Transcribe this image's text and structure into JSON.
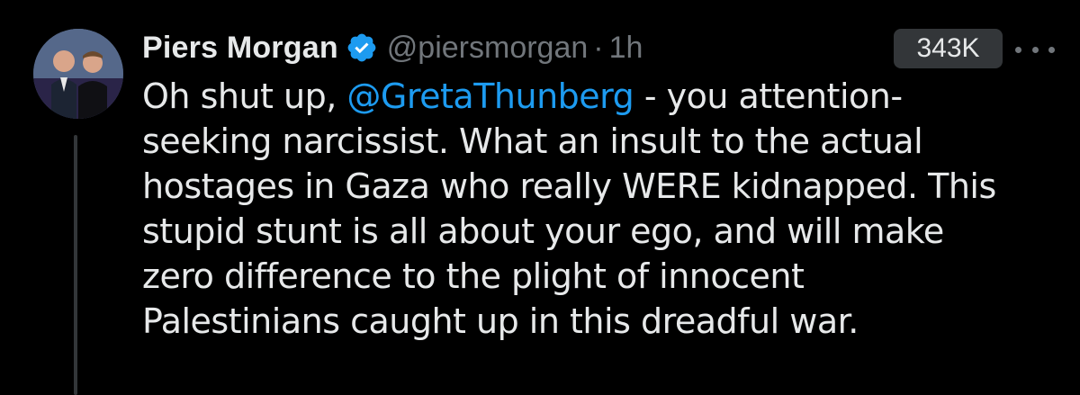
{
  "author": {
    "display_name": "Piers Morgan",
    "handle": "@piersmorgan",
    "separator": "·",
    "time": "1h",
    "verified": true
  },
  "stats": {
    "views": "343K"
  },
  "tweet": {
    "lines": [
      {
        "before": "Oh shut up, ",
        "mention": "@GretaThunberg",
        "after": " - you attention-"
      },
      {
        "text": "seeking narcissist. What an insult to the actual"
      },
      {
        "text": "hostages in Gaza who really WERE kidnapped. This"
      },
      {
        "text": "stupid stunt is all about your ego, and will make"
      },
      {
        "text": "zero difference to the plight of innocent"
      },
      {
        "text": "Palestinians caught up in this dreadful war."
      }
    ]
  },
  "icons": {
    "verified": "verified-badge-icon",
    "more": "more-options-icon"
  },
  "colors": {
    "background": "#000000",
    "text": "#e7e9ea",
    "secondary_text": "#71767b",
    "mention": "#1d9bf0",
    "verified": "#1d9bf0",
    "badge_bg": "#333639"
  }
}
